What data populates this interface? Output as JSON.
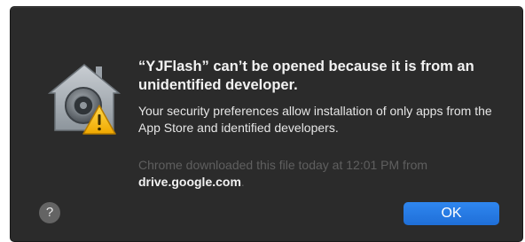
{
  "dialog": {
    "title": "“YJFlash” can’t be opened because it is from an unidentified developer.",
    "message": "Your security preferences allow installation of only apps from the App Store and identified developers.",
    "source_prefix": "Chrome downloaded this file today at 12:01 PM from",
    "source_domain": "drive.google.com",
    "source_suffix": ".",
    "help_label": "?",
    "ok_label": "OK"
  },
  "icons": {
    "security": "gatekeeper-house-warning-icon"
  },
  "colors": {
    "dialog_background": "#2b2b2b",
    "primary_button": "#1f6fd8",
    "warning": "#f5c518"
  }
}
